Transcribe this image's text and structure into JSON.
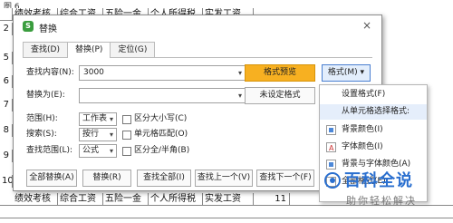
{
  "caption": "图 6",
  "sheet": {
    "top_row": [
      "绩效考核",
      "综合工资",
      "五险一金",
      "个人所得税",
      "实发工资"
    ],
    "left_col": [
      "2",
      "5",
      "6",
      "7",
      "8",
      "9",
      "10"
    ],
    "bottom_row": [
      "绩效考核",
      "综合工资",
      "五险一金",
      "个人所得税",
      "实发工资"
    ],
    "bottom_num": "11"
  },
  "dialog": {
    "title": "替换",
    "app_icon": "S",
    "close": "×",
    "tabs": [
      "查找(D)",
      "替换(P)",
      "定位(G)"
    ],
    "active_tab": 1,
    "find_label": "查找内容(N):",
    "find_value": "3000",
    "replace_label": "替换为(E):",
    "replace_value": "",
    "format_preview": "格式预览",
    "format_button": "格式(M) ▾",
    "no_format_button": "未设定格式",
    "scope_label": "范围(H):",
    "scope_value": "工作表",
    "search_label": "搜索(S):",
    "search_value": "按行",
    "lookin_label": "查找范围(L):",
    "lookin_value": "公式",
    "match_case": "区分大小写(C)",
    "match_cell": "单元格匹配(O)",
    "match_width": "区分全/半角(B)",
    "buttons": [
      "全部替换(A)",
      "替换(R)",
      "查找全部(I)",
      "查找上一个(V)",
      "查找下一个(F)"
    ]
  },
  "menu": {
    "items": [
      "设置格式(F)",
      "从单元格选择格式:",
      "背景颜色(I)",
      "字体颜色(I)",
      "背景与字体颜色(A)",
      "全部格式(E)"
    ]
  },
  "watermark": {
    "title": "百科全说",
    "subtitle": "助你轻松解决"
  },
  "colors": {
    "accent_orange": "#f7b021",
    "accent_blue": "#2a6fcf",
    "app_green": "#3a9d3e"
  }
}
